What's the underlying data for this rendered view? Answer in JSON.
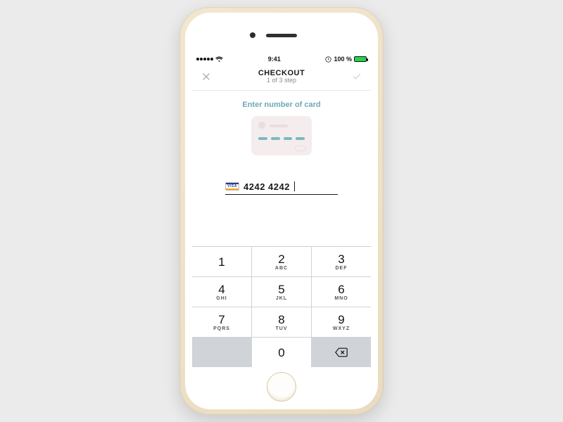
{
  "status_bar": {
    "time": "9:41",
    "battery_pct": "100 %"
  },
  "nav": {
    "title": "CHECKOUT",
    "step": "1 of 3 step"
  },
  "content": {
    "prompt": "Enter number of card",
    "card_brand": "VISA",
    "card_value": "4242 4242"
  },
  "keypad": {
    "keys": [
      {
        "d": "1",
        "sub": ""
      },
      {
        "d": "2",
        "sub": "ABC"
      },
      {
        "d": "3",
        "sub": "DEF"
      },
      {
        "d": "4",
        "sub": "GHI"
      },
      {
        "d": "5",
        "sub": "JKL"
      },
      {
        "d": "6",
        "sub": "MNO"
      },
      {
        "d": "7",
        "sub": "PQRS"
      },
      {
        "d": "8",
        "sub": "TUV"
      },
      {
        "d": "9",
        "sub": "WXYZ"
      },
      {
        "d": "0",
        "sub": ""
      }
    ]
  }
}
